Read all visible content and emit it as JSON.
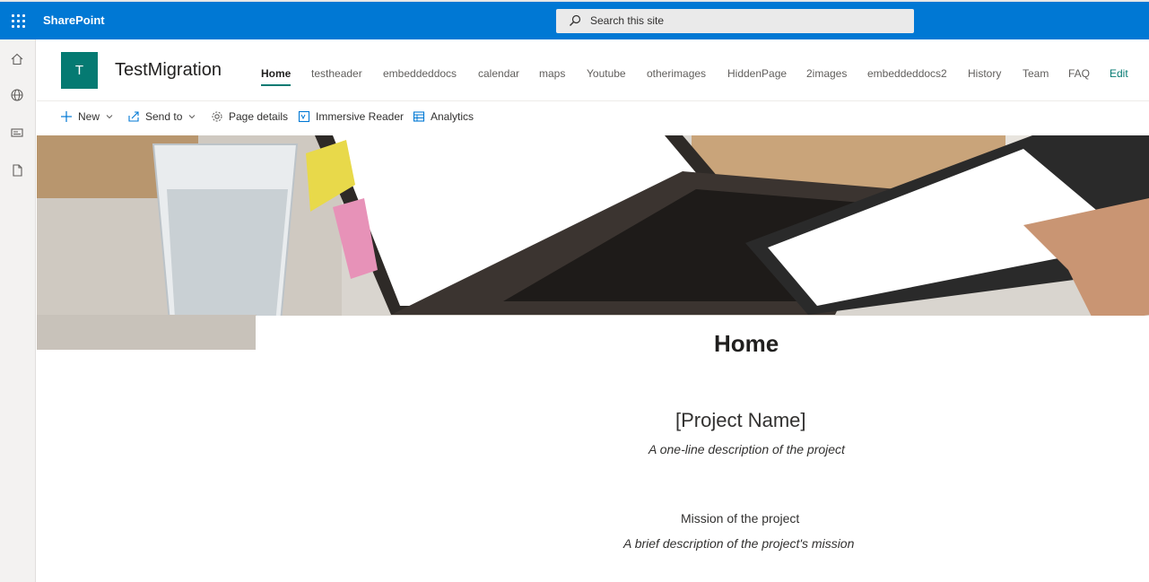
{
  "suite_bar": {
    "brand": "SharePoint",
    "search_placeholder": "Search this site",
    "accent_color": "#0078d4"
  },
  "left_rail": {
    "icons": [
      "home-icon",
      "globe-icon",
      "news-icon",
      "page-icon"
    ]
  },
  "site_header": {
    "logo_letter": "T",
    "logo_color": "#057a72",
    "title": "TestMigration",
    "nav": {
      "home": "Home",
      "testheader": "testheader",
      "embeddeddocs": "embeddeddocs",
      "calendar": "calendar",
      "maps": "maps",
      "youtube": "Youtube",
      "otherimages": "otherimages",
      "hiddenpage": "HiddenPage",
      "twoimages": "2images",
      "embeddeddocs2": "embeddeddocs2",
      "history": "History",
      "team": "Team",
      "faq": "FAQ",
      "edit": "Edit"
    },
    "active_nav": "Home"
  },
  "command_bar": {
    "new": "New",
    "send_to": "Send to",
    "page_details": "Page details",
    "immersive_reader": "Immersive Reader",
    "analytics": "Analytics"
  },
  "page": {
    "title": "Home",
    "project_name": "[Project Name]",
    "project_description": "A one-line description of the project",
    "mission_title": "Mission of the project",
    "mission_description": "A brief description of the project's mission"
  }
}
